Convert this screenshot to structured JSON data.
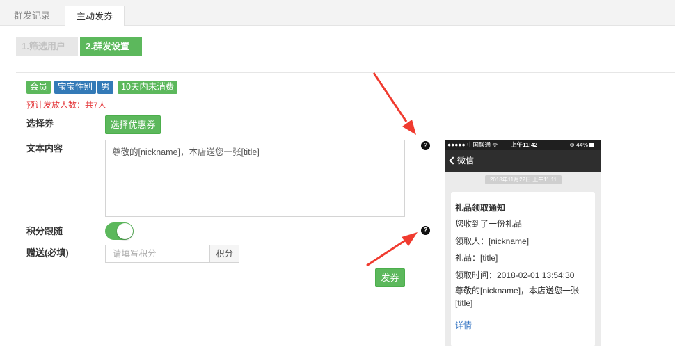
{
  "tabs": [
    {
      "label": "群发记录"
    },
    {
      "label": "主动发券"
    }
  ],
  "steps": [
    {
      "label": "1.筛选用户"
    },
    {
      "label": "2.群发设置"
    }
  ],
  "tags": [
    {
      "label": "会员",
      "color": "#5cb85c"
    },
    {
      "label": "宝宝性别",
      "color": "#337ab7"
    },
    {
      "label": "男",
      "color": "#337ab7"
    },
    {
      "label": "10天内未消费",
      "color": "#5cb85c"
    }
  ],
  "estimate_text": "预计发放人数：共7人",
  "form": {
    "coupon_label": "选择券",
    "coupon_button": "选择优惠券",
    "text_label": "文本内容",
    "text_value": "尊敬的[nickname]，本店送您一张[title]",
    "points_follow_label": "积分跟随",
    "points_follow_on": true,
    "gift_label": "赠送(必填)",
    "gift_placeholder": "请填写积分",
    "gift_unit": "积分",
    "submit_button": "发券"
  },
  "help_icon": "?",
  "phone": {
    "carrier": "●●●●● 中国联通 ᯤ",
    "time": "上午11:42",
    "battery": "⊕ 44%",
    "nav_back": "微信",
    "date": "2018年11月22日 上午11:11",
    "card": {
      "title": "礼品领取通知",
      "line1": "您收到了一份礼品",
      "line2": "领取人：[nickname]",
      "line3": "礼品：[title]",
      "line4": "领取时间：2018-02-01 13:54:30",
      "content": "尊敬的[nickname]，本店送您一张[title]",
      "link": "详情"
    }
  },
  "colors": {
    "primary_green": "#5cb85c",
    "tag_blue": "#337ab7",
    "warning_red": "#e4393c",
    "annotation_arrow": "#f03b2f"
  }
}
